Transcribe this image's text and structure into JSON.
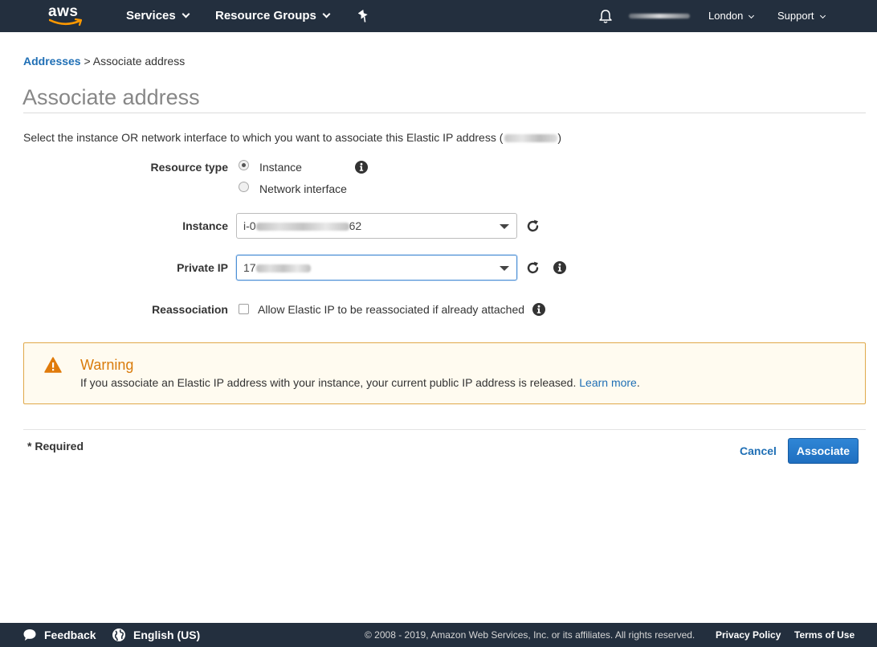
{
  "topnav": {
    "logo_text": "aws",
    "services": "Services",
    "resource_groups": "Resource Groups",
    "region": "London",
    "support": "Support"
  },
  "breadcrumb": {
    "parent": "Addresses",
    "separator": ">",
    "current": "Associate address"
  },
  "page_title": "Associate address",
  "intro": {
    "text": "Select the instance OR network interface to which you want to associate this Elastic IP address (",
    "close": ")"
  },
  "form": {
    "resource_type_label": "Resource type",
    "resource_type_options": [
      "Instance",
      "Network interface"
    ],
    "resource_type_selected": "Instance",
    "instance_label": "Instance",
    "instance_value_prefix": "i-0",
    "instance_value_suffix": "62",
    "private_ip_label": "Private IP",
    "private_ip_value_prefix": "17",
    "reassociation_label": "Reassociation",
    "reassociation_checkbox_label": "Allow Elastic IP to be reassociated if already attached",
    "reassociation_checked": false
  },
  "warning": {
    "title": "Warning",
    "text": "If you associate an Elastic IP address with your instance, your current public IP address is released.",
    "link": "Learn more",
    "after_link": "."
  },
  "footer": {
    "required": "* Required",
    "cancel": "Cancel",
    "associate": "Associate"
  },
  "bottombar": {
    "feedback": "Feedback",
    "language": "English (US)",
    "copyright": "© 2008 - 2019, Amazon Web Services, Inc. or its affiliates. All rights reserved.",
    "privacy": "Privacy Policy",
    "terms": "Terms of Use"
  },
  "colors": {
    "nav_bg": "#232f3e",
    "link": "#1f6fb5",
    "primary_button": "#1f6fc0",
    "warning_border": "#e0a94a",
    "warning_title": "#d97b0b",
    "aws_smile": "#ff9900"
  },
  "icons": {
    "logo": "aws-logo-icon",
    "pin": "pin-icon",
    "bell": "bell-icon",
    "info": "info-icon",
    "refresh": "refresh-icon",
    "warning": "warning-triangle-icon",
    "feedback": "speech-bubble-icon",
    "language": "globe-icon"
  }
}
